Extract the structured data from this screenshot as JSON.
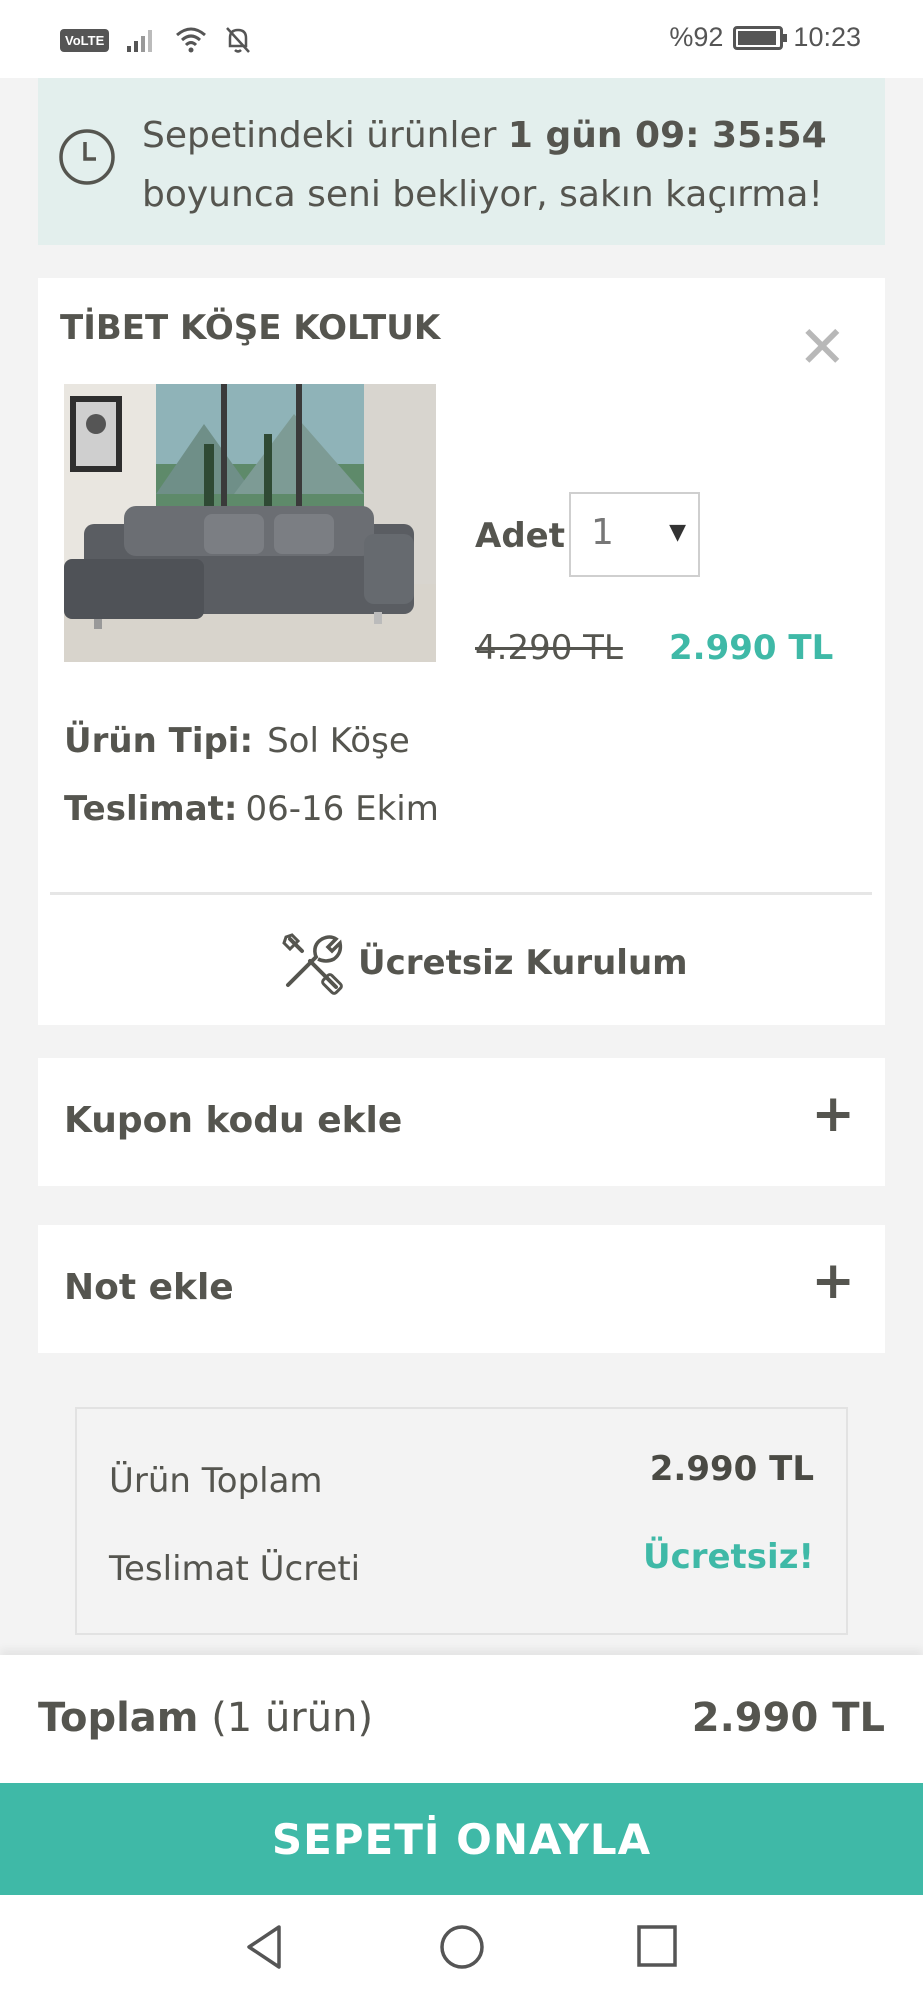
{
  "status_bar": {
    "volte": "VoLTE",
    "battery_percent": "%92",
    "time": "10:23"
  },
  "timer": {
    "text_before": "Sepetindeki ürünler ",
    "countdown": "1 gün 09: 35:54",
    "text_after": "boyunca seni bekliyor, sakın kaçırma!"
  },
  "product": {
    "name": "TİBET KÖŞE KOLTUK",
    "quantity_label": "Adet",
    "quantity_value": "1",
    "old_price": "4.290 TL",
    "new_price": "2.990 TL",
    "type_label": "Ürün Tipi:",
    "type_value": "Sol Köşe",
    "delivery_label": "Teslimat:",
    "delivery_value": "06-16 Ekim",
    "install_label": "Ücretsiz Kurulum"
  },
  "accordions": {
    "coupon_label": "Kupon kodu ekle",
    "note_label": "Not ekle"
  },
  "summary": {
    "product_total_label": "Ürün Toplam",
    "product_total_value": "2.990 TL",
    "delivery_fee_label": "Teslimat Ücreti",
    "delivery_fee_value": "Ücretsiz!"
  },
  "footer": {
    "total_label": "Toplam",
    "total_count": "(1 ürün)",
    "total_value": "2.990 TL",
    "confirm_label": "SEPETİ ONAYLA"
  },
  "colors": {
    "accent": "#3fb9a7",
    "text": "#55554f",
    "banner_bg": "#e3efed"
  }
}
